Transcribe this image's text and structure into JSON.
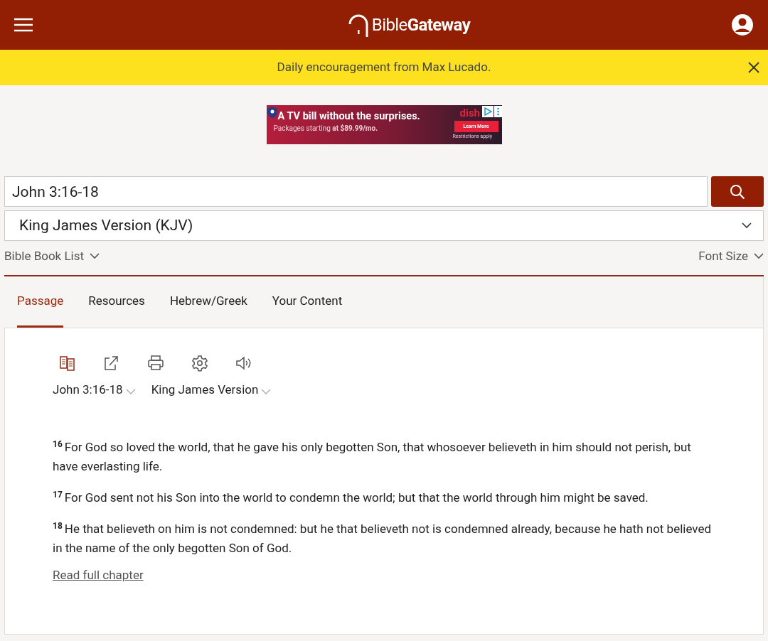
{
  "header": {
    "logo": "Bible**Gateway**"
  },
  "banner": {
    "text": "Daily encouragement from Max Lucado."
  },
  "ad": {
    "headline": "A TV bill without the surprises.",
    "subline": "Packages starting **at $89.99/mo.**",
    "brand": "dish",
    "cta": "Learn More",
    "fine_print": "Restrictions apply"
  },
  "search": {
    "value": "John 3:16-18"
  },
  "version_select": {
    "value": "King James Version (KJV)"
  },
  "links": {
    "book_list": "Bible Book List",
    "font_size": "Font Size"
  },
  "tabs": [
    {
      "label": "Passage",
      "selected": true
    },
    {
      "label": "Resources",
      "selected": false
    },
    {
      "label": "Hebrew/Greek",
      "selected": false
    },
    {
      "label": "Your Content",
      "selected": false
    }
  ],
  "toolbar": [
    {
      "kind": "parallel",
      "active": true
    },
    {
      "kind": "share",
      "active": false
    },
    {
      "kind": "print",
      "active": false
    },
    {
      "kind": "settings",
      "active": false
    },
    {
      "kind": "audio",
      "active": false
    }
  ],
  "passage": {
    "reference": "John 3:16-18",
    "version": "King James Version",
    "verses": [
      {
        "number": "16",
        "text": "For God so loved the world, that he gave his only begotten Son, that whosoever believeth in him should not perish, but have everlasting life."
      },
      {
        "number": "17",
        "text": "For God sent not his Son into the world to condemn the world; but that the world through him might be saved."
      },
      {
        "number": "18",
        "text": "He that believeth on him is not condemned: but he that believeth not is condemned already, because he hath not believed in the name of the only begotten Son of God."
      }
    ],
    "read_more": "Read full chapter"
  }
}
